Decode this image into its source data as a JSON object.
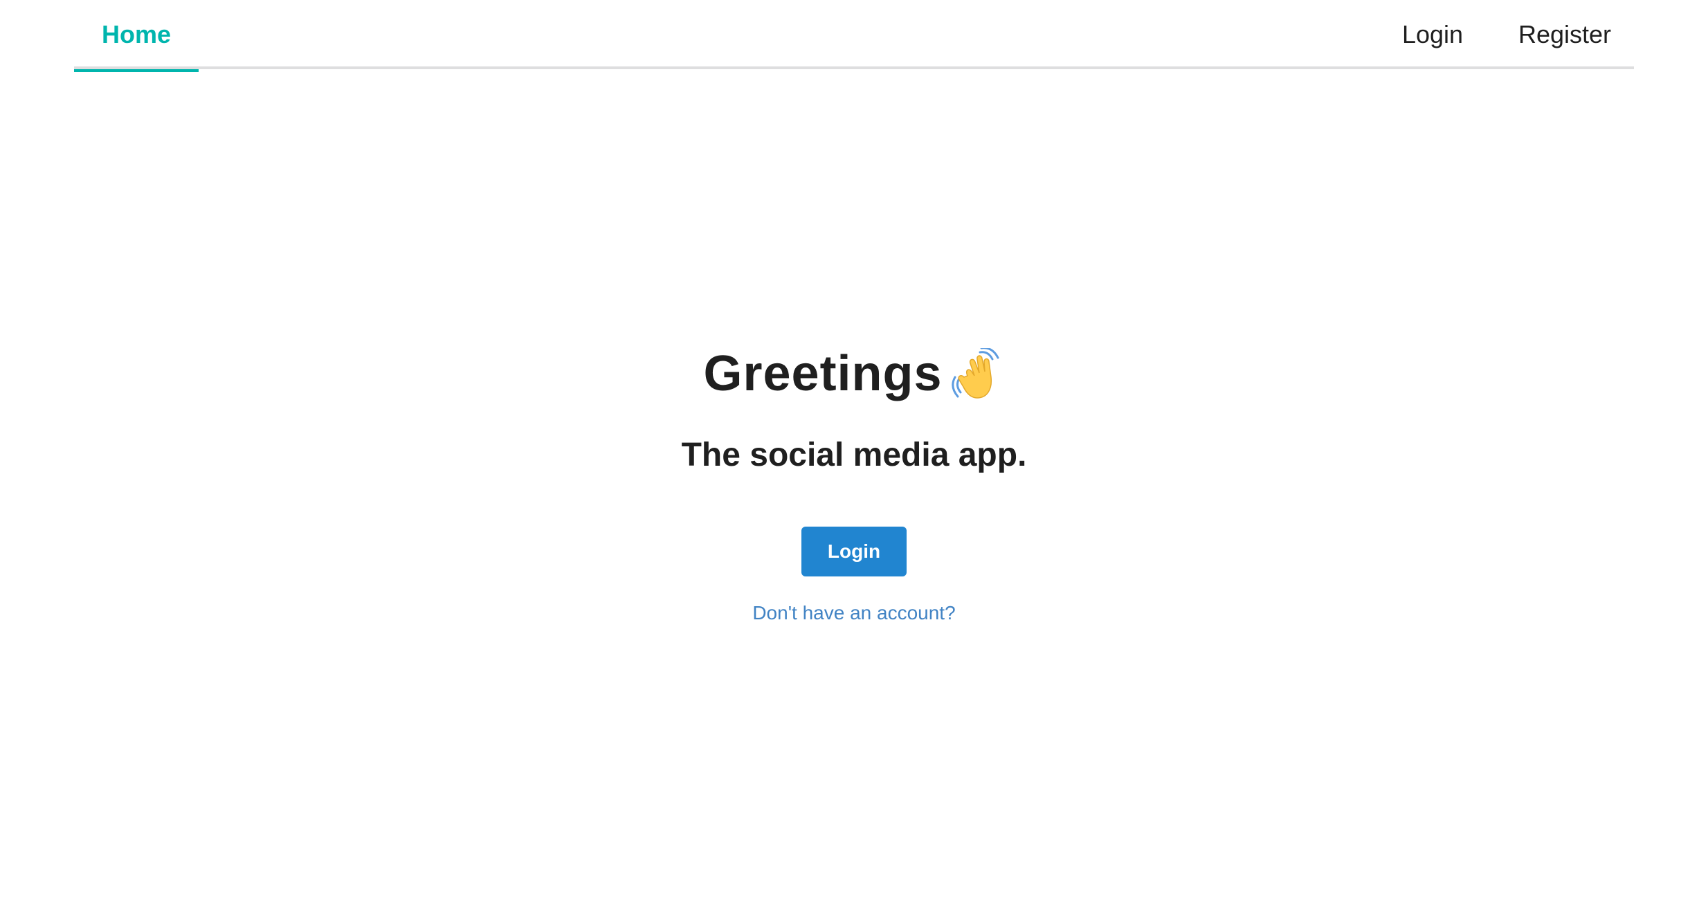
{
  "navbar": {
    "home_label": "Home",
    "login_label": "Login",
    "register_label": "Register"
  },
  "hero": {
    "title": "Greetings",
    "title_icon": "waving-hand-icon",
    "subtitle": "The social media app.",
    "login_button_label": "Login",
    "register_link_label": "Don't have an account?"
  },
  "colors": {
    "accent_teal": "#00b5ad",
    "primary_blue": "#2185d0",
    "link_blue": "#4183c4",
    "text_dark": "#1f1f1f",
    "divider_gray": "#dededf"
  }
}
